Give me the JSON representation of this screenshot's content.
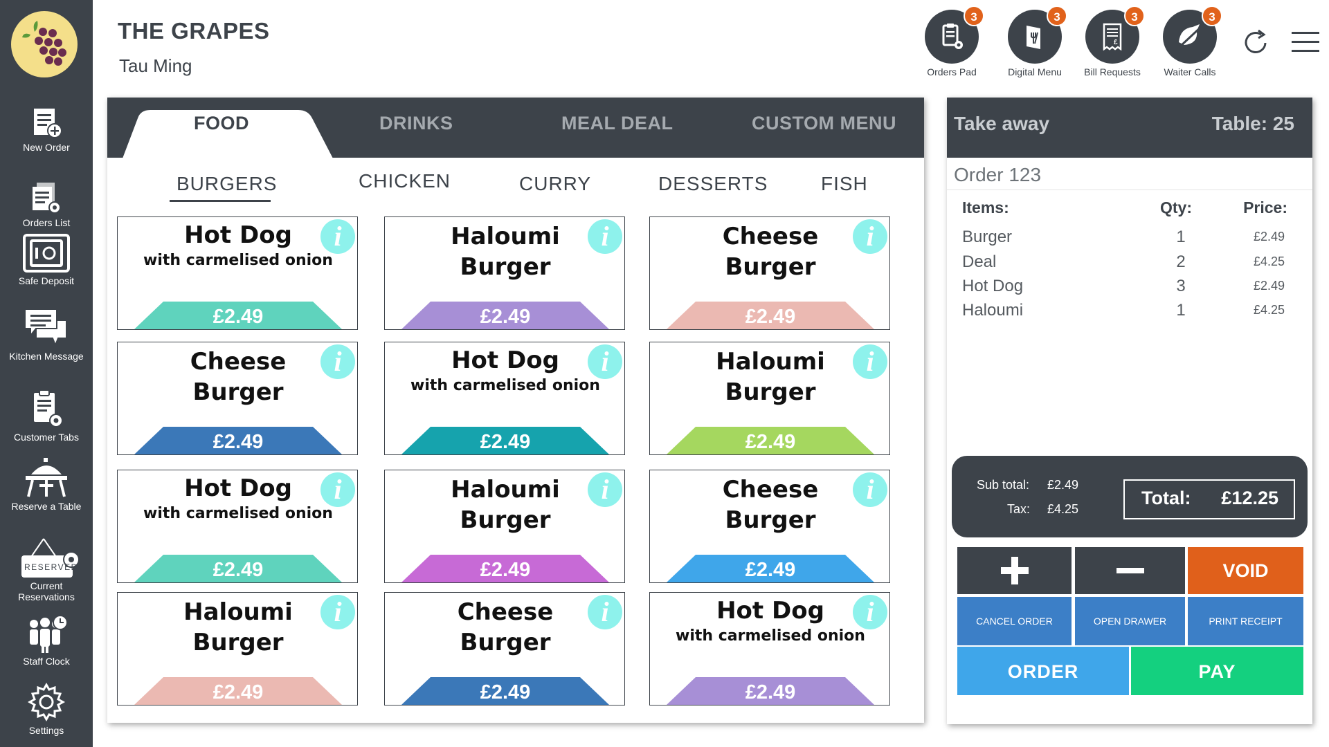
{
  "sidebar": {
    "items": [
      {
        "label": "New Order",
        "icon": "new-order-icon"
      },
      {
        "label": "Orders List",
        "icon": "orders-list-icon"
      },
      {
        "label": "Safe Deposit",
        "icon": "safe-icon"
      },
      {
        "label": "Kitchen Message",
        "icon": "chat-icon"
      },
      {
        "label": "Customer Tabs",
        "icon": "clipboard-icon"
      },
      {
        "label": "Reserve a Table",
        "icon": "table-icon"
      },
      {
        "label": "Current Reservations",
        "icon": "reserved-sign-icon",
        "sign_text": "RESERVED"
      },
      {
        "label": "Staff Clock",
        "icon": "staff-clock-icon"
      },
      {
        "label": "Settings",
        "icon": "gear-icon"
      }
    ]
  },
  "header": {
    "restaurant_name": "THE GRAPES",
    "user_name": "Tau Ming",
    "buttons": [
      {
        "label": "Orders Pad",
        "badge": "3",
        "icon": "orders-pad-icon"
      },
      {
        "label": "Digital Menu",
        "badge": "3",
        "icon": "digital-menu-icon"
      },
      {
        "label": "Bill Requests",
        "badge": "3",
        "icon": "bill-icon"
      },
      {
        "label": "Waiter Calls",
        "badge": "3",
        "icon": "waiter-call-icon"
      }
    ]
  },
  "menu": {
    "categories": [
      "FOOD",
      "DRINKS",
      "MEAL DEAL",
      "CUSTOM MENU"
    ],
    "active_category": "FOOD",
    "subcategories": [
      "BURGERS",
      "CHICKEN",
      "CURRY",
      "DESSERTS",
      "FISH"
    ],
    "active_subcategory": "BURGERS",
    "items": [
      {
        "name": "Hot Dog",
        "sub": "with carmelised onion",
        "price": "£2.49",
        "color": "#5fd3bd"
      },
      {
        "name": "Haloumi Burger",
        "sub": "",
        "price": "£2.49",
        "color": "#a78fd6"
      },
      {
        "name": "Cheese Burger",
        "sub": "",
        "price": "£2.49",
        "color": "#ebb9b2"
      },
      {
        "name": "Cheese Burger",
        "sub": "",
        "price": "£2.49",
        "color": "#3b78b8"
      },
      {
        "name": "Hot Dog",
        "sub": "with carmelised onion",
        "price": "£2.49",
        "color": "#16a3ad"
      },
      {
        "name": "Haloumi Burger",
        "sub": "",
        "price": "£2.49",
        "color": "#a5d75f"
      },
      {
        "name": "Hot Dog",
        "sub": "with carmelised onion",
        "price": "£2.49",
        "color": "#5fd3bd"
      },
      {
        "name": "Haloumi Burger",
        "sub": "",
        "price": "£2.49",
        "color": "#c76ad6"
      },
      {
        "name": "Cheese Burger",
        "sub": "",
        "price": "£2.49",
        "color": "#3fa6ea"
      },
      {
        "name": "Haloumi Burger",
        "sub": "",
        "price": "£2.49",
        "color": "#ebb9b2"
      },
      {
        "name": "Cheese Burger",
        "sub": "",
        "price": "£2.49",
        "color": "#3b78b8"
      },
      {
        "name": "Hot Dog",
        "sub": "with carmelised onion",
        "price": "£2.49",
        "color": "#a78fd6"
      }
    ]
  },
  "order": {
    "type": "Take away",
    "table": "Table: 25",
    "number": "Order 123",
    "headers": {
      "items": "Items:",
      "qty": "Qty:",
      "price": "Price:"
    },
    "lines": [
      {
        "name": "Burger",
        "qty": "1",
        "price": "£2.49"
      },
      {
        "name": "Deal",
        "qty": "2",
        "price": "£4.25"
      },
      {
        "name": "Hot Dog",
        "qty": "3",
        "price": "£2.49"
      },
      {
        "name": "Haloumi",
        "qty": "1",
        "price": "£4.25"
      }
    ],
    "subtotal_label": "Sub total:",
    "subtotal_value": "£2.49",
    "tax_label": "Tax:",
    "tax_value": "£4.25",
    "total_label": "Total:",
    "total_value": "£12.25"
  },
  "actions": {
    "void": "VOID",
    "cancel_order": "CANCEL ORDER",
    "open_drawer": "OPEN DRAWER",
    "print_receipt": "PRINT RECEIPT",
    "order": "ORDER",
    "pay": "PAY"
  },
  "colors": {
    "dark": "#3d434a",
    "badge": "#e1621b",
    "void": "#e0601b",
    "blue_btn": "#3c7fc7",
    "order_btn": "#3fa6ea",
    "pay_btn": "#14d07f",
    "info": "#8ef2ec"
  }
}
